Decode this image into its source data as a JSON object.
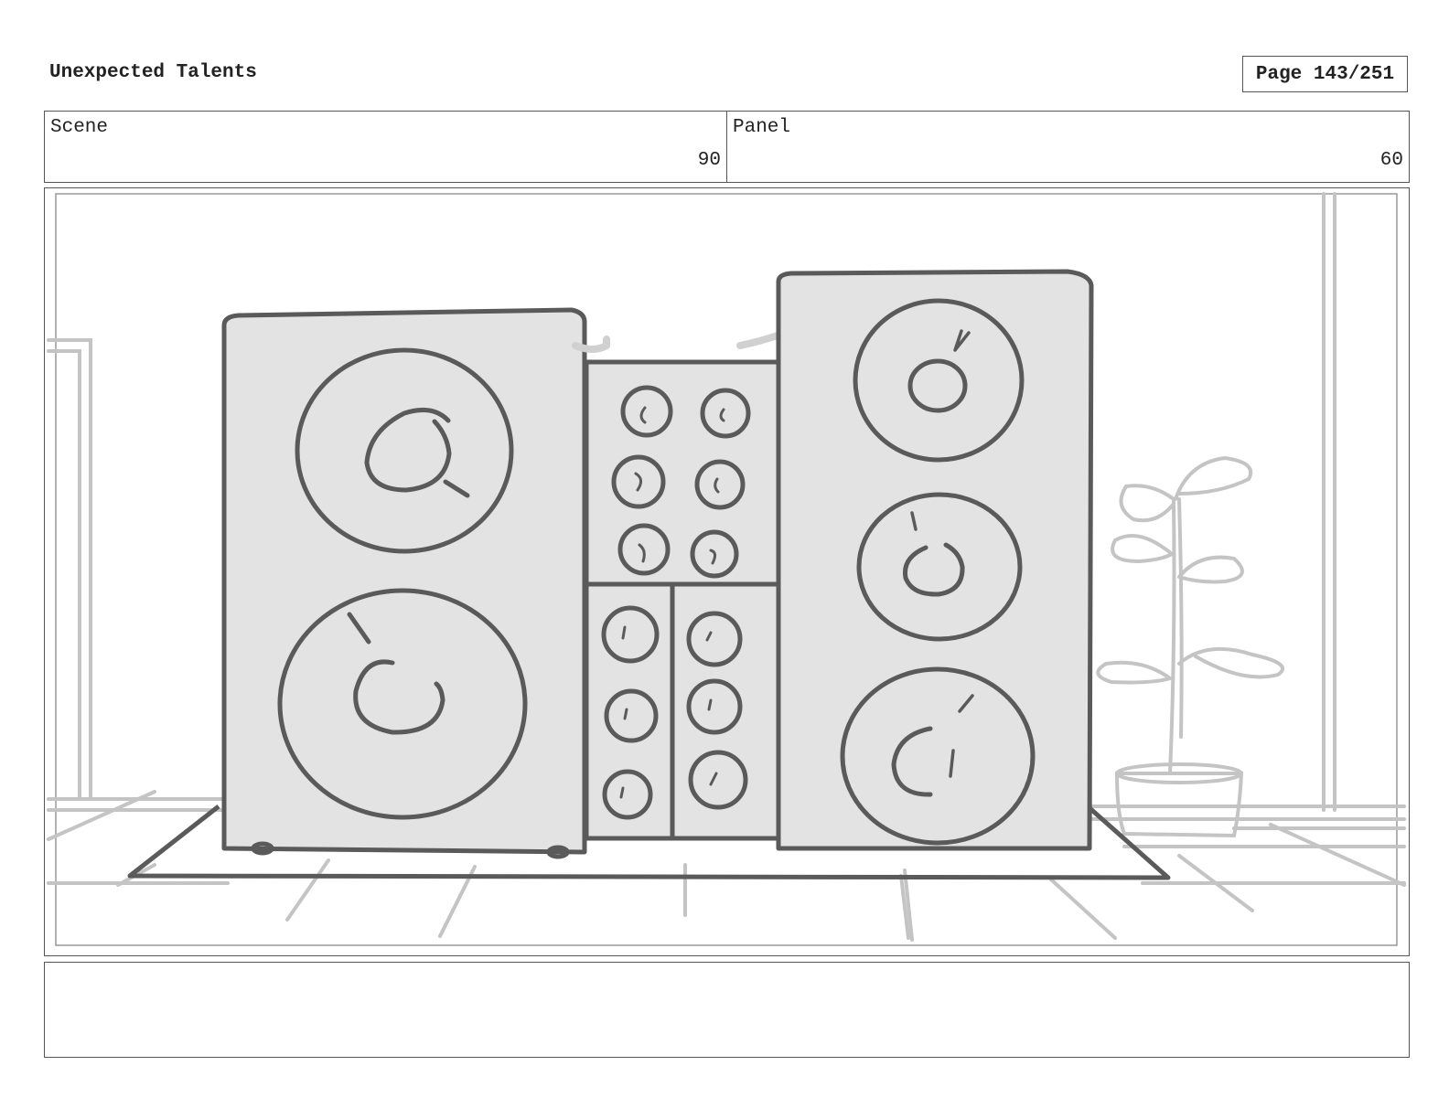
{
  "header": {
    "title": "Unexpected Talents",
    "page": "Page 143/251"
  },
  "info": {
    "scene_label": "Scene",
    "scene_value": "90",
    "panel_label": "Panel",
    "panel_value": "60"
  },
  "notes": {
    "text": ""
  },
  "colors": {
    "ink": "#555555",
    "fill": "#e3e3e3",
    "background_sketch": "#c4c4c4"
  }
}
